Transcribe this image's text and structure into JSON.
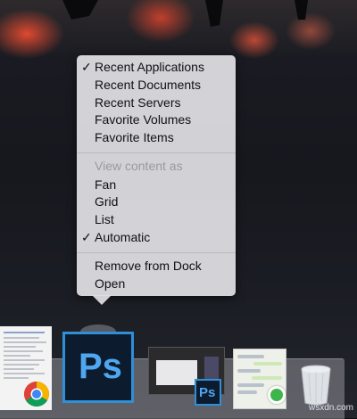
{
  "menu": {
    "items": [
      {
        "label": "Recent Applications",
        "checked": true
      },
      {
        "label": "Recent Documents",
        "checked": false
      },
      {
        "label": "Recent Servers",
        "checked": false
      },
      {
        "label": "Favorite Volumes",
        "checked": false
      },
      {
        "label": "Favorite Items",
        "checked": false
      }
    ],
    "view_section_header": "View content as",
    "view_items": [
      {
        "label": "Fan",
        "checked": false
      },
      {
        "label": "Grid",
        "checked": false
      },
      {
        "label": "List",
        "checked": false
      },
      {
        "label": "Automatic",
        "checked": true
      }
    ],
    "actions": [
      {
        "label": "Remove from Dock"
      },
      {
        "label": "Open"
      }
    ],
    "check_glyph": "✓"
  },
  "dock": {
    "photoshop_label": "Ps",
    "photoshop_small_label": "Ps",
    "icons": [
      "document-thumbnail",
      "chrome-icon",
      "photoshop-icon",
      "screen-thumbnail",
      "photoshop-small-icon",
      "chat-thumbnail",
      "phone-icon",
      "trash-icon"
    ]
  },
  "colors": {
    "menu_bg": "#dedee2",
    "ps_blue": "#4fa7ef",
    "ps_border": "#2f8fd8",
    "disabled_text": "#9a9a9e"
  },
  "watermark": "wsxdn.com"
}
